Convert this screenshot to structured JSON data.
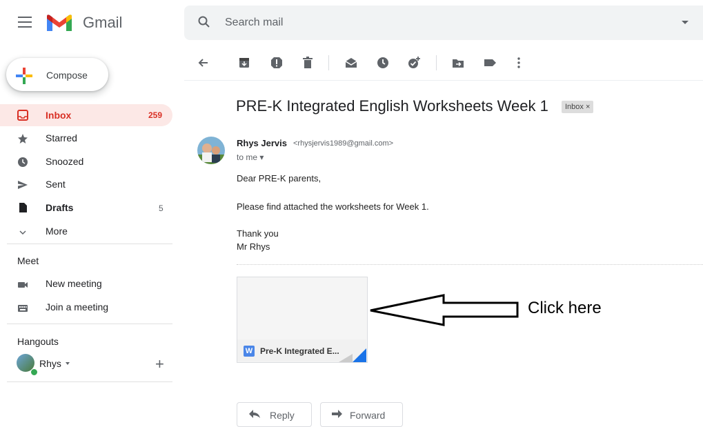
{
  "app": {
    "name": "Gmail"
  },
  "search": {
    "placeholder": "Search mail"
  },
  "compose": {
    "label": "Compose"
  },
  "sidebar": {
    "items": [
      {
        "label": "Inbox",
        "count": "259"
      },
      {
        "label": "Starred",
        "count": ""
      },
      {
        "label": "Snoozed",
        "count": ""
      },
      {
        "label": "Sent",
        "count": ""
      },
      {
        "label": "Drafts",
        "count": "5"
      },
      {
        "label": "More",
        "count": ""
      }
    ]
  },
  "meet": {
    "title": "Meet",
    "items": [
      {
        "label": "New meeting"
      },
      {
        "label": "Join a meeting"
      }
    ]
  },
  "hangouts": {
    "title": "Hangouts",
    "user": "Rhys"
  },
  "email": {
    "subject": "PRE-K Integrated English Worksheets Week 1",
    "label_chip": "Inbox ×",
    "sender_name": "Rhys Jervis",
    "sender_email": "<rhysjervis1989@gmail.com>",
    "recipient": "to me ▾",
    "greeting": "Dear PRE-K parents,",
    "body": "Please find attached the worksheets for Week 1.",
    "closing1": "Thank you",
    "closing2": "Mr Rhys"
  },
  "attachment": {
    "name": "Pre-K Integrated E..."
  },
  "annotation": {
    "text": "Click here"
  },
  "actions": {
    "reply": "Reply",
    "forward": "Forward"
  }
}
